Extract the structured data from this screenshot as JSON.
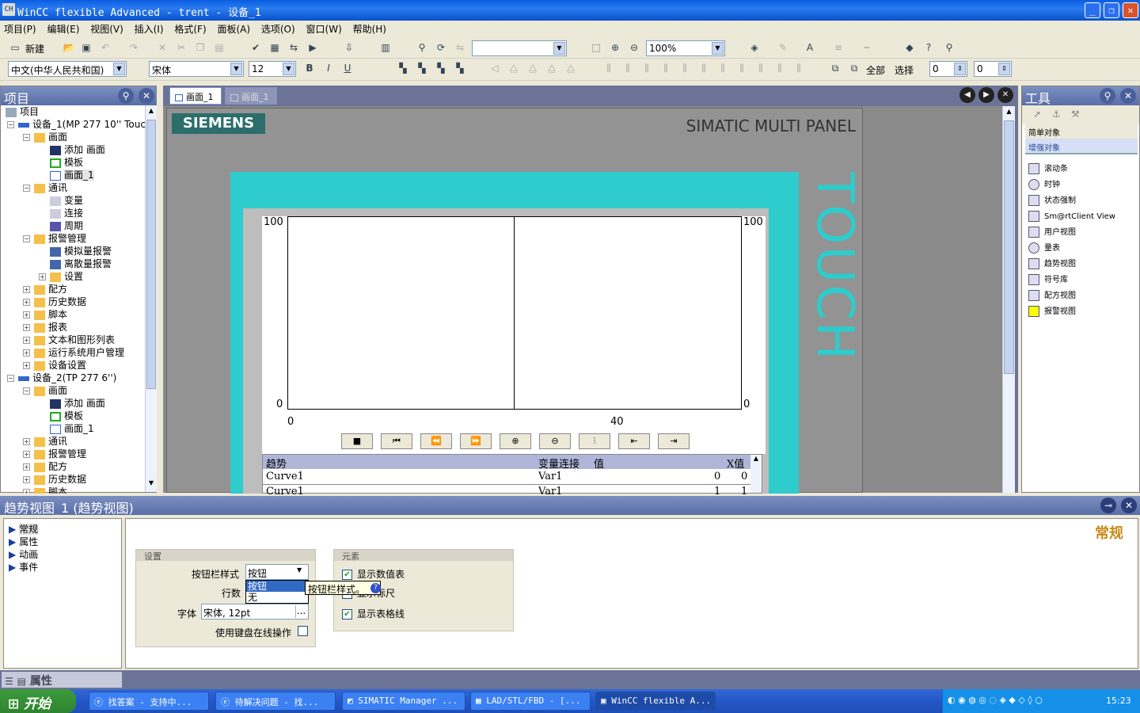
{
  "window": {
    "title": "WinCC flexible Advanced - trent - 设备_1",
    "min": "_",
    "max": "❐",
    "close": "✕"
  },
  "menu": [
    "项目(P)",
    "编辑(E)",
    "视图(V)",
    "插入(I)",
    "格式(F)",
    "面板(A)",
    "选项(O)",
    "窗口(W)",
    "帮助(H)"
  ],
  "toolbar1": {
    "new_label": "新建",
    "zoom_value": "100%",
    "empty_combo": ""
  },
  "toolbar2": {
    "language": "中文(中华人民共和国)",
    "font": "宋体",
    "size": "12",
    "bold": "B",
    "italic": "I",
    "underline": "U",
    "all_label": "全部",
    "select_label": "选择",
    "spin1": "0",
    "spin2": "0"
  },
  "project": {
    "title": "项目",
    "items": [
      "项目",
      "设备_1(MP 277 10'' Touc",
      "画面",
      "添加 画面",
      "模板",
      "画面_1",
      "通讯",
      "变量",
      "连接",
      "周期",
      "报警管理",
      "模拟量报警",
      "离散量报警",
      "设置",
      "配方",
      "历史数据",
      "脚本",
      "报表",
      "文本和图形列表",
      "运行系统用户管理",
      "设备设置",
      "设备_2(TP 277 6'')",
      "画面",
      "添加 画面",
      "模板",
      "画面_1",
      "通讯",
      "报警管理",
      "配方",
      "历史数据",
      "脚本"
    ]
  },
  "editor": {
    "tabs": [
      "画面_1",
      "画面_1"
    ],
    "brand": "SIEMENS",
    "panel_name": "SIMATIC MULTI PANEL",
    "touch": "TOUCH",
    "trend": {
      "y_left_max": "100",
      "y_left_min": "0",
      "y_right_max": "100",
      "y_right_min": "0",
      "x_start": "0",
      "x_mid": "40",
      "table_headers": [
        "趋势",
        "变量连接",
        "值",
        "X值"
      ],
      "rows": [
        [
          "Curve1",
          "Var1",
          "0",
          "0"
        ],
        [
          "Curve1",
          "Var1",
          "1",
          "1"
        ]
      ]
    }
  },
  "tools": {
    "title": "工具",
    "groups": [
      "简单对象",
      "增强对象"
    ],
    "items": [
      "滚动条",
      "时钟",
      "状态强制",
      "Sm@rtClient View",
      "用户视图",
      "量表",
      "趋势视图",
      "符号库",
      "配方视图",
      "报警视图"
    ]
  },
  "properties": {
    "title": "趋势视图_1 (趋势视图)",
    "nav": [
      "常规",
      "属性",
      "动画",
      "事件"
    ],
    "heading": "常规",
    "settings_group": "设置",
    "button_style_label": "按钮栏样式",
    "button_style_value": "按钮",
    "dropdown_options": [
      "按钮",
      "无"
    ],
    "tooltip": "按钮栏样式。",
    "rows_label": "行数",
    "font_label": "字体",
    "font_value": "宋体, 12pt",
    "font_btn": "...",
    "keyboard_label": "使用键盘在线操作",
    "elements_group": "元素",
    "show_value_table": "显示数值表",
    "show_ruler": "显示标尺",
    "show_grid": "显示表格线",
    "bottom_tab": "属性"
  },
  "taskbar": {
    "start": "开始",
    "tasks": [
      "找答案 - 支持中...",
      "待解决问题 - 找...",
      "SIMATIC Manager ...",
      "LAD/STL/FBD - [...",
      "WinCC flexible A..."
    ],
    "clock": "15:23"
  },
  "colors": {
    "accent": "#2ecccc",
    "title_blue": "#0a5ee0",
    "panel_grey": "#8a8a8a",
    "editor_bg": "#6b7396"
  }
}
